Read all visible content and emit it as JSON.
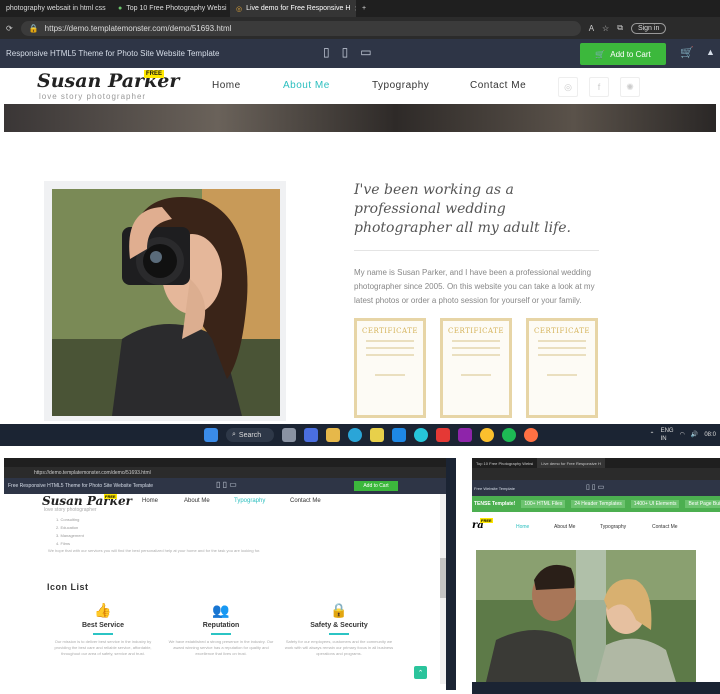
{
  "top": {
    "tabs": [
      {
        "label": "photography websait in html css",
        "active": false
      },
      {
        "label": "Top 10 Free Photography Websi",
        "active": false
      },
      {
        "label": "Live demo for Free Responsive H",
        "active": true
      }
    ],
    "url": "https://demo.templatemonster.com/demo/51693.html",
    "signin": "Sign in",
    "tm_title": "Responsive HTML5 Theme for Photo Site Website Template",
    "add_to_cart": "Add to Cart",
    "logo": "Susan Parker",
    "free_badge": "FREE",
    "tagline": "love story photographer",
    "nav": [
      "Home",
      "About Me",
      "Typography",
      "Contact Me"
    ],
    "nav_active_color": "#2bbfbf",
    "quote": "I've been working as a professional wedding photographer all my adult life.",
    "paragraph": "My name is Susan Parker, and I have been a professional wedding photographer since 2005. On this website you can take a look at my latest photos or order a photo session for yourself or your family.",
    "certificates": [
      "CERTIFICATE",
      "CERTIFICATE",
      "CERTIFICATE"
    ],
    "taskbar_search": "Search",
    "lang": "ENG",
    "lang_region": "IN",
    "time": "08:0"
  },
  "bottom_left": {
    "url": "https://demo.templatemonster.com/demo/51693.html",
    "tm_title": "Free Responsive HTML5 Theme for Photo Site Website Template",
    "add_to_cart": "Add to Cart",
    "logo": "Susan Parker",
    "free_badge": "FREE",
    "tagline": "love story photographer",
    "nav": [
      "Home",
      "About Me",
      "Typography",
      "Contact Me"
    ],
    "list_items": [
      "Consulting",
      "Education",
      "Management",
      "Films"
    ],
    "small_text": "We hope that with our services you will find the best personalized help at your home and for the task you are looking for.",
    "section_title": "Icon List",
    "features": [
      {
        "icon": "thumbs-up-icon",
        "glyph": "👍",
        "title": "Best Service",
        "desc": "Our mission is to deliver best service in the industry by providing the best care and reliable service, affordable, throughout our area of safety, service and trust."
      },
      {
        "icon": "users-icon",
        "glyph": "👥",
        "title": "Reputation",
        "desc": "We have established a strong presence in the industry. Our award winning service has a reputation for quality and excellence that lives on trust."
      },
      {
        "icon": "lock-icon",
        "glyph": "🔒",
        "title": "Safety & Security",
        "desc": "Safety for our employees, customers and the community we work with will always remain our primary focus in all business operations and programs."
      }
    ]
  },
  "bottom_right": {
    "tabs": [
      "Top 10 Free Photography Websi",
      "Live demo for Free Responsive H"
    ],
    "tm_title": "Free Website Template",
    "promo_title": "TENSE Template!",
    "promo_items": [
      "100+ HTML Files",
      "24 Header Templates",
      "1400+ UI Elements",
      "Best Page Buil"
    ],
    "free_badge": "FREE",
    "nav": [
      "Home",
      "About Me",
      "Typography",
      "Contact Me"
    ]
  }
}
